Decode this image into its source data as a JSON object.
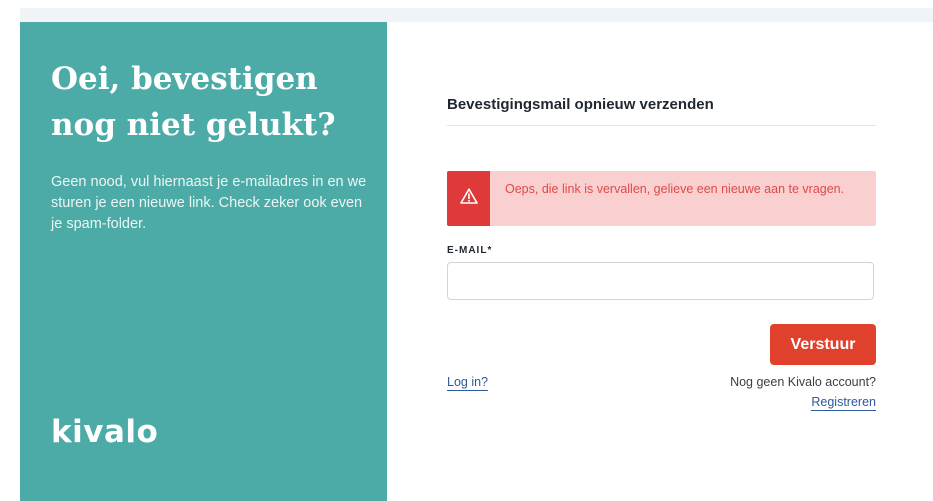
{
  "left": {
    "headline": "Oei, bevestigen nog niet gelukt?",
    "intro": "Geen nood, vul hiernaast je e-mailadres in en we sturen je een nieuwe link. Check zeker ook even je spam-folder.",
    "logo": "kivalo",
    "background_color": "#4caba6"
  },
  "form": {
    "title": "Bevestigingsmail opnieuw verzenden",
    "alert": {
      "icon": "warning-triangle-icon",
      "message": "Oeps, die link is vervallen, gelieve een nieuwe aan te vragen.",
      "color": "#de3a3a"
    },
    "email_label": "E-MAIL*",
    "email_value": "",
    "submit_label": "Verstuur",
    "submit_color": "#e0412c",
    "login_link": "Log in?",
    "no_account_text": "Nog geen Kivalo account?",
    "register_link": "Registreren"
  }
}
